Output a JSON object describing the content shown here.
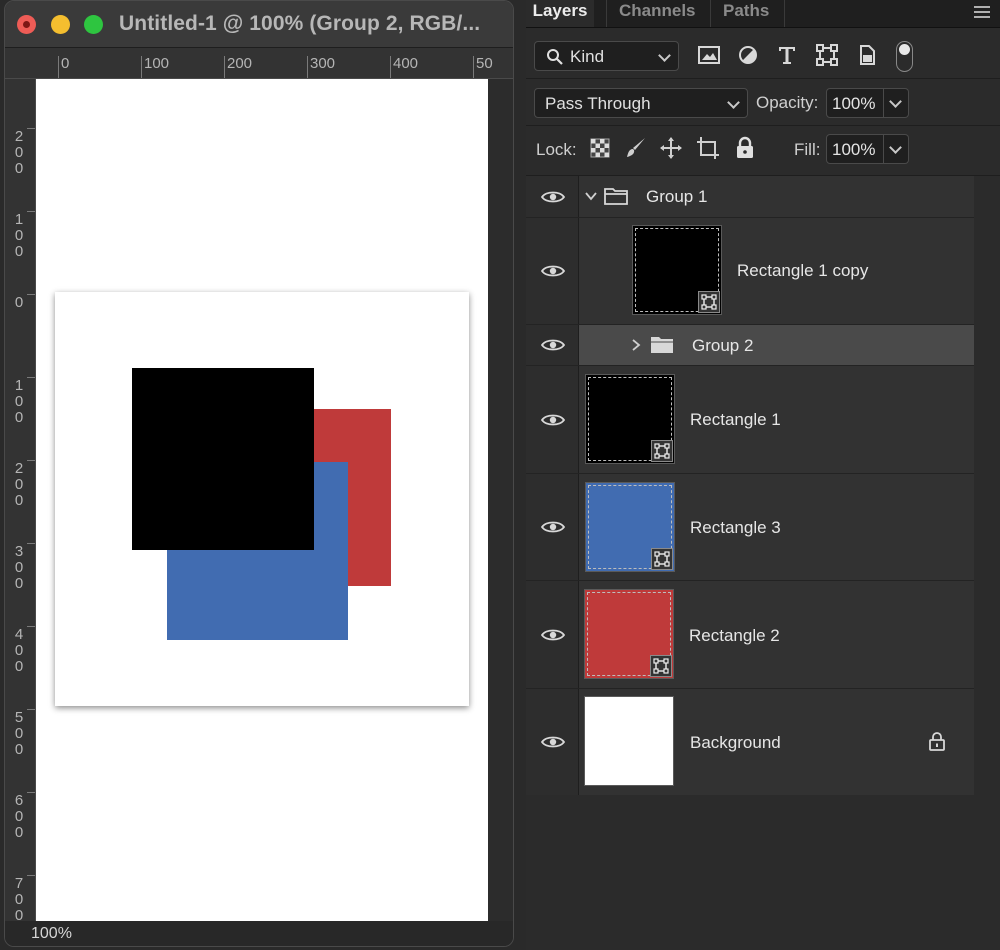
{
  "document": {
    "title": "Untitled-1 @ 100% (Group 2, RGB/...",
    "zoom": "100%",
    "ruler_h_labels": [
      "0",
      "100",
      "200",
      "300",
      "400",
      "50"
    ],
    "ruler_v_labels": [
      "2\n0\n0",
      "1\n0\n0",
      "0",
      "1\n0\n0",
      "2\n0\n0",
      "3\n0\n0",
      "4\n0\n0",
      "5\n0\n0",
      "6\n0\n0",
      "7\n0\n0"
    ]
  },
  "colors": {
    "red": "#bf3a3a",
    "blue": "#416cb1",
    "black": "#000000",
    "white": "#ffffff"
  },
  "panel": {
    "tabs": [
      "Layers",
      "Channels",
      "Paths"
    ],
    "active_tab": "Layers",
    "filter_kind": "Kind",
    "filter_icons": [
      "image-filter-icon",
      "adjustment-filter-icon",
      "type-filter-icon",
      "shape-filter-icon",
      "smart-object-filter-icon"
    ],
    "blend_mode": "Pass Through",
    "opacity_label": "Opacity:",
    "opacity": "100%",
    "lock_label": "Lock:",
    "lock_icons": [
      "lock-transparent-icon",
      "lock-image-icon",
      "lock-position-icon",
      "lock-artboard-icon",
      "lock-all-icon"
    ],
    "fill_label": "Fill:",
    "fill": "100%"
  },
  "layers": [
    {
      "name": "Group 1",
      "type": "group",
      "expanded": true,
      "indent": 0
    },
    {
      "name": "Rectangle 1 copy",
      "type": "shape",
      "color": "#000000",
      "indent": 1
    },
    {
      "name": "Group 2",
      "type": "group",
      "expanded": false,
      "selected": true,
      "indent": 1
    },
    {
      "name": "Rectangle 1",
      "type": "shape",
      "color": "#000000",
      "indent": 0
    },
    {
      "name": "Rectangle 3",
      "type": "shape",
      "color": "#416cb1",
      "indent": 0
    },
    {
      "name": "Rectangle 2",
      "type": "shape",
      "color": "#bf3a3a",
      "indent": 0
    },
    {
      "name": "Background",
      "type": "background",
      "color": "#ffffff",
      "locked": true,
      "indent": 0
    }
  ]
}
